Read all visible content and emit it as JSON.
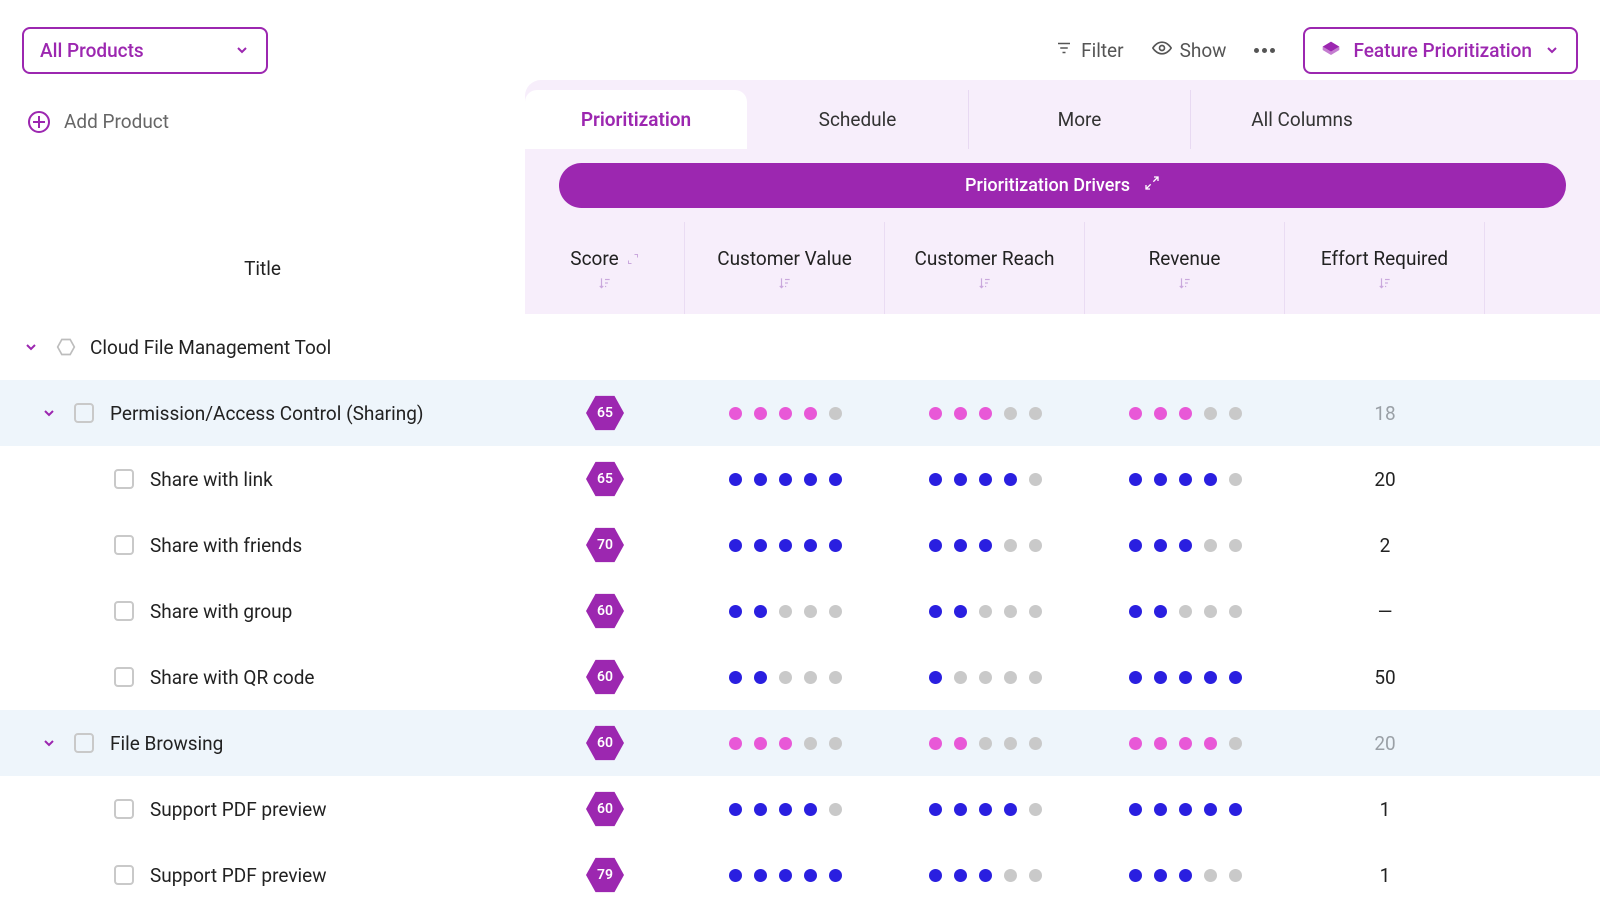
{
  "header": {
    "product_selector": "All Products",
    "filter": "Filter",
    "show": "Show",
    "view_selector": "Feature Prioritization"
  },
  "addbar": {
    "label": "Add Product"
  },
  "tabs": [
    {
      "label": "Prioritization",
      "active": true
    },
    {
      "label": "Schedule",
      "active": false
    },
    {
      "label": "More",
      "active": false
    },
    {
      "label": "All Columns",
      "active": false
    }
  ],
  "drivers_button": "Prioritization Drivers",
  "columns": {
    "title": "Title",
    "score": "Score",
    "customer_value": "Customer Value",
    "customer_reach": "Customer Reach",
    "revenue": "Revenue",
    "effort": "Effort Required"
  },
  "product": {
    "name": "Cloud File Management Tool"
  },
  "groups": [
    {
      "name": "Permission/Access Control (Sharing)",
      "score": 65,
      "dot_color": "pink",
      "customer_value": 4,
      "customer_reach": 3,
      "revenue": 3,
      "effort": "18",
      "effort_muted": true,
      "items": [
        {
          "name": "Share with link",
          "score": 65,
          "customer_value": 5,
          "customer_reach": 4,
          "revenue": 4,
          "effort": "20"
        },
        {
          "name": "Share with friends",
          "score": 70,
          "customer_value": 5,
          "customer_reach": 3,
          "revenue": 3,
          "effort": "2"
        },
        {
          "name": "Share with group",
          "score": 60,
          "customer_value": 2,
          "customer_reach": 2,
          "revenue": 2,
          "effort": "—"
        },
        {
          "name": "Share with QR code",
          "score": 60,
          "customer_value": 2,
          "customer_reach": 1,
          "revenue": 5,
          "effort": "50"
        }
      ]
    },
    {
      "name": "File Browsing",
      "score": 60,
      "dot_color": "pink",
      "customer_value": 3,
      "customer_reach": 2,
      "revenue": 4,
      "effort": "20",
      "effort_muted": true,
      "items": [
        {
          "name": "Support PDF preview",
          "score": 60,
          "customer_value": 4,
          "customer_reach": 4,
          "revenue": 5,
          "effort": "1"
        },
        {
          "name": "Support PDF preview",
          "score": 79,
          "customer_value": 5,
          "customer_reach": 3,
          "revenue": 3,
          "effort": "1"
        }
      ]
    }
  ]
}
